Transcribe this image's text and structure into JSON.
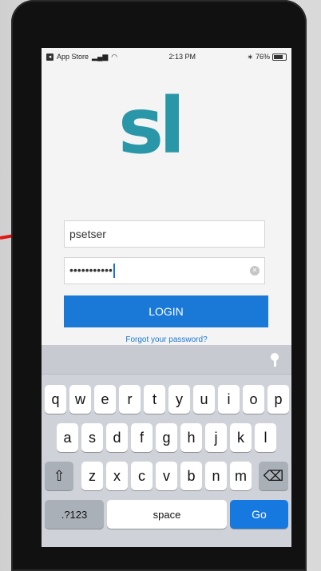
{
  "status_bar": {
    "back_app": "App Store",
    "time": "2:13 PM",
    "battery": "76%",
    "battery_level": 0.76
  },
  "logo": {
    "text": "sl"
  },
  "login_form": {
    "username_value": "psetser",
    "password_value": "•••••••••••",
    "login_button": "LOGIN",
    "forgot_link": "Forgot your password?"
  },
  "keyboard": {
    "row1": [
      "q",
      "w",
      "e",
      "r",
      "t",
      "y",
      "u",
      "i",
      "o",
      "p"
    ],
    "row2": [
      "a",
      "s",
      "d",
      "f",
      "g",
      "h",
      "j",
      "k",
      "l"
    ],
    "row3": [
      "z",
      "x",
      "c",
      "v",
      "b",
      "n",
      "m"
    ],
    "shift_label": "⇧",
    "delete_label": "⌫",
    "numbers_label": ".?123",
    "space_label": "space",
    "go_label": "Go"
  },
  "colors": {
    "accent": "#1a79d6",
    "logo": "#2a97a8",
    "annotation_arrow": "#e01818"
  }
}
